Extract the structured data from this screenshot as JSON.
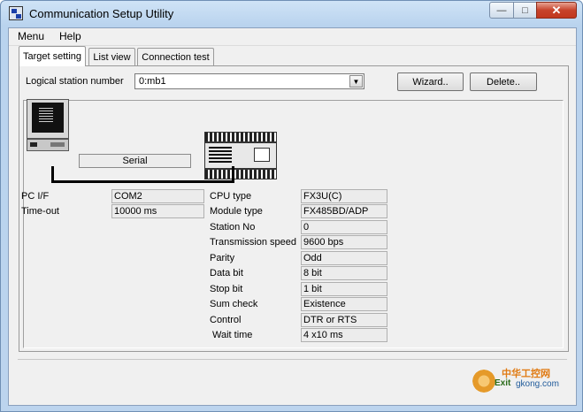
{
  "window": {
    "title": "Communication Setup Utility"
  },
  "menubar": {
    "items": [
      "Menu",
      "Help"
    ]
  },
  "tabs": [
    {
      "label": "Target setting",
      "active": true
    },
    {
      "label": "List view",
      "active": false
    },
    {
      "label": "Connection test",
      "active": false
    }
  ],
  "target": {
    "logical_station_label": "Logical station number",
    "logical_station_value": "0:mb1",
    "wizard_label": "Wizard..",
    "delete_label": "Delete.."
  },
  "diagram": {
    "link_label": "Serial"
  },
  "pc": {
    "fields": [
      {
        "label": "PC I/F",
        "value": "COM2"
      },
      {
        "label": "Time-out",
        "value": "10000 ms"
      }
    ]
  },
  "plc": {
    "fields": [
      {
        "label": "CPU type",
        "value": "FX3U(C)"
      },
      {
        "label": "Module type",
        "value": "FX485BD/ADP"
      },
      {
        "label": "Station No",
        "value": "0"
      },
      {
        "label": "Transmission speed",
        "value": "9600 bps"
      },
      {
        "label": "Parity",
        "value": "Odd"
      },
      {
        "label": "Data bit",
        "value": "8 bit"
      },
      {
        "label": "Stop bit",
        "value": "1 bit"
      },
      {
        "label": "Sum check",
        "value": "Existence"
      },
      {
        "label": "Control",
        "value": "DTR or RTS"
      },
      {
        "label": "Wait time",
        "value": "4 x10 ms"
      }
    ]
  },
  "footer": {
    "exit_label": "Exit",
    "watermark_text": "中华工控网",
    "watermark_url": "gkong.com"
  },
  "icons": {
    "app": "app-icon",
    "minimize": "minimize-icon",
    "maximize": "maximize-icon",
    "close": "close-icon",
    "pc": "pc-icon",
    "plc": "plc-icon",
    "combo_arrow": "chevron-down-icon",
    "exit": "gear-icon"
  },
  "colors": {
    "title_bar": "#b9d3ee",
    "close_button": "#c7432b",
    "panel": "#f0f0f0"
  }
}
